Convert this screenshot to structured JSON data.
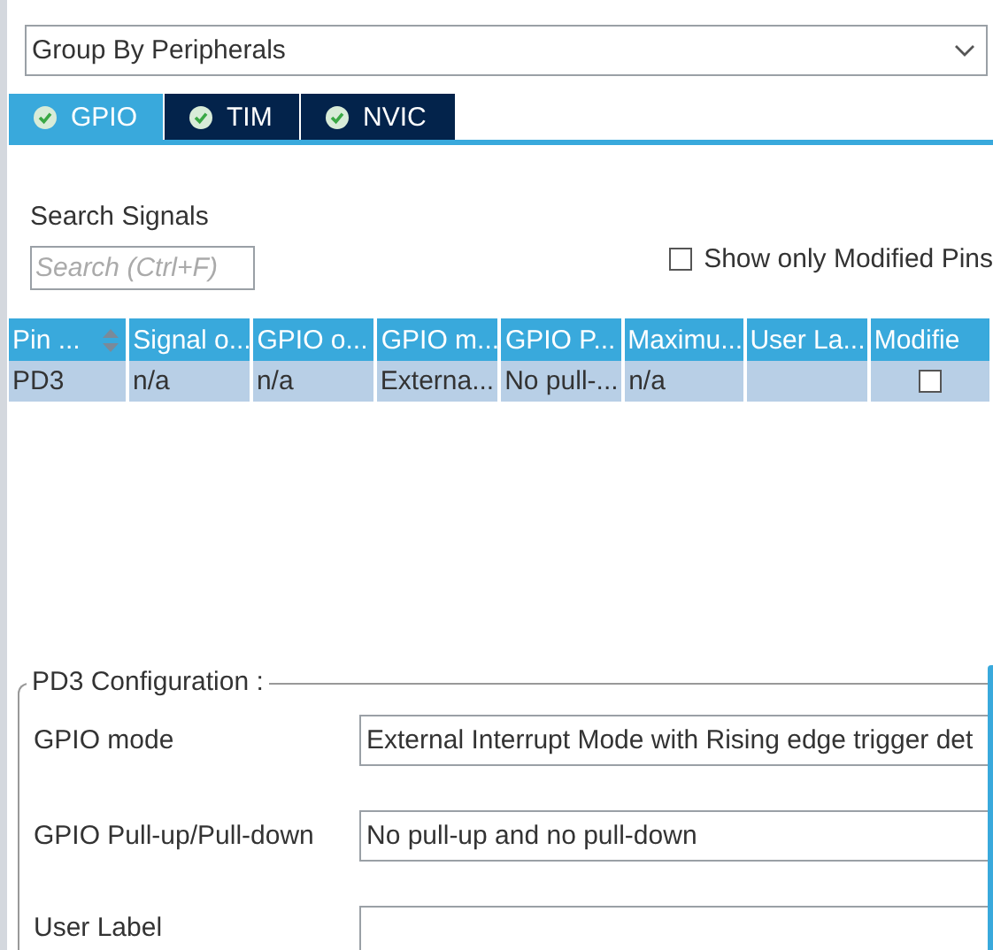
{
  "group_by": {
    "value": "Group By Peripherals"
  },
  "tabs": [
    {
      "label": "GPIO",
      "selected": true
    },
    {
      "label": "TIM",
      "selected": false
    },
    {
      "label": "NVIC",
      "selected": false
    }
  ],
  "search": {
    "label": "Search Signals",
    "placeholder": "Search (Ctrl+F)"
  },
  "show_modified": {
    "label": "Show only Modified Pins",
    "checked": false
  },
  "table": {
    "columns": [
      {
        "label": "Pin ...",
        "sortable": true
      },
      {
        "label": "Signal o..."
      },
      {
        "label": "GPIO o..."
      },
      {
        "label": "GPIO m..."
      },
      {
        "label": "GPIO P..."
      },
      {
        "label": "Maximu..."
      },
      {
        "label": "User La..."
      },
      {
        "label": "Modifie"
      }
    ],
    "rows": [
      {
        "selected": true,
        "cells": [
          "PD3",
          "n/a",
          "n/a",
          "Externa...",
          "No pull-...",
          "n/a",
          ""
        ],
        "modified": false
      }
    ]
  },
  "configuration": {
    "title": "PD3 Configuration :",
    "fields": [
      {
        "label": "GPIO mode",
        "value": "External Interrupt Mode with Rising edge trigger det"
      },
      {
        "label": "GPIO Pull-up/Pull-down",
        "value": "No pull-up and no pull-down"
      },
      {
        "label": "User Label"
      }
    ]
  }
}
